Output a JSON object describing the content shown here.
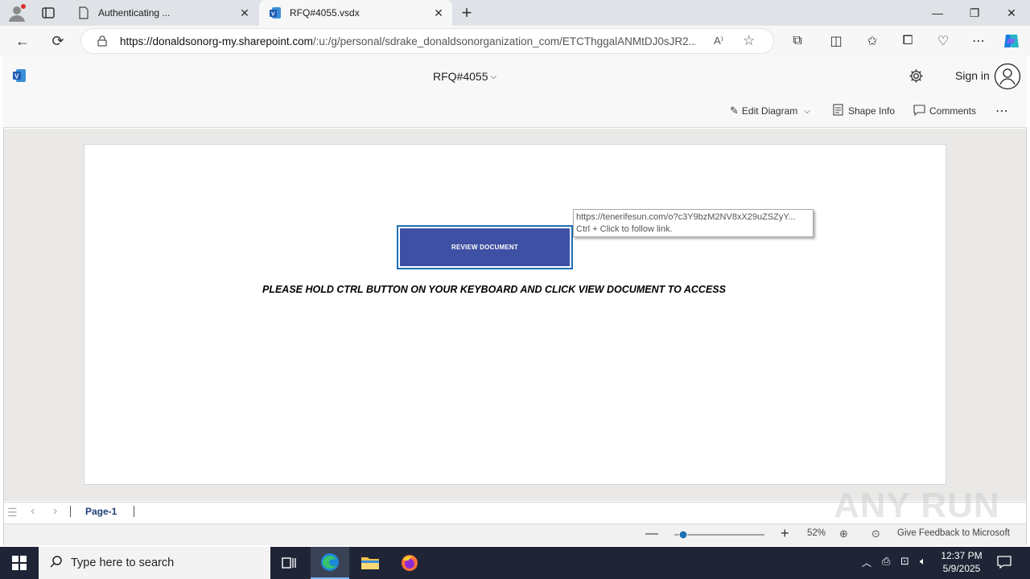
{
  "browser": {
    "tabs": [
      {
        "label": "Authenticating ..."
      },
      {
        "label": "RFQ#4055.vsdx"
      }
    ],
    "url_host": "https://donaldsonorg-my.sharepoint.com",
    "url_path": "/:u:/g/personal/sdrake_donaldsonorganization_com/ETCThggalANMtDJ0sJR2..."
  },
  "visio": {
    "doc_title": "RFQ#4055",
    "sign_in": "Sign in",
    "toolbar": {
      "edit_diagram": "Edit Diagram",
      "shape_info": "Shape Info",
      "comments": "Comments"
    }
  },
  "canvas": {
    "button_label": "REVIEW DOCUMENT",
    "tooltip_url": "https://tenerifesun.com/o?c3Y9bzM2NV8xX29uZSZyY...",
    "tooltip_hint": "Ctrl + Click to follow link.",
    "instruction": "PLEASE HOLD CTRL BUTTON ON YOUR KEYBOARD AND CLICK VIEW DOCUMENT TO ACCESS"
  },
  "pages": {
    "current": "Page-1"
  },
  "status": {
    "zoom": "52%",
    "feedback": "Give Feedback to Microsoft"
  },
  "taskbar": {
    "search_placeholder": "Type here to search",
    "time": "12:37 PM",
    "date": "5/9/2025"
  },
  "watermark": "ANY RUN",
  "colors": {
    "visio_blue": "#3e50a3",
    "link_border": "#1f6fb5"
  }
}
